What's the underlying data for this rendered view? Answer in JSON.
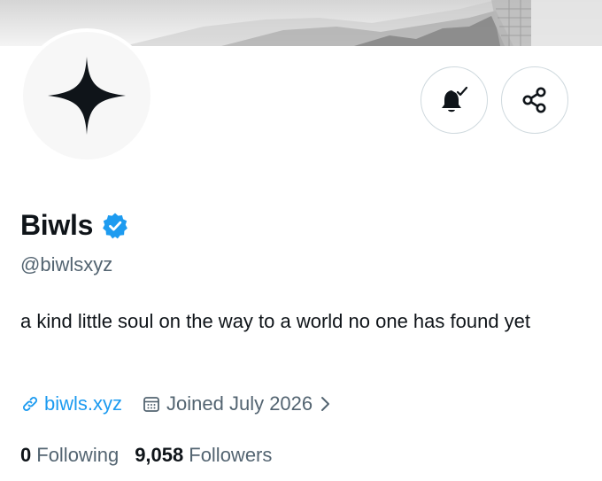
{
  "profile": {
    "display_name": "Biwls",
    "handle": "@biwlsxyz",
    "bio": "a kind little soul on the way to a world no one has found yet",
    "website": "biwls.xyz",
    "joined": "Joined July 2026",
    "following_count": "0",
    "following_label": "Following",
    "followers_count": "9,058",
    "followers_label": "Followers"
  },
  "icons": {
    "avatar": "four-point-star",
    "verified": "verified-badge-icon",
    "notify": "bell-check-icon",
    "share": "share-icon",
    "link": "link-icon",
    "calendar": "calendar-icon",
    "chevron": "chevron-right-icon"
  },
  "colors": {
    "accent": "#1d9bf0",
    "secondary_text": "#536471",
    "primary_text": "#0f1419",
    "border": "#cfd9de"
  }
}
